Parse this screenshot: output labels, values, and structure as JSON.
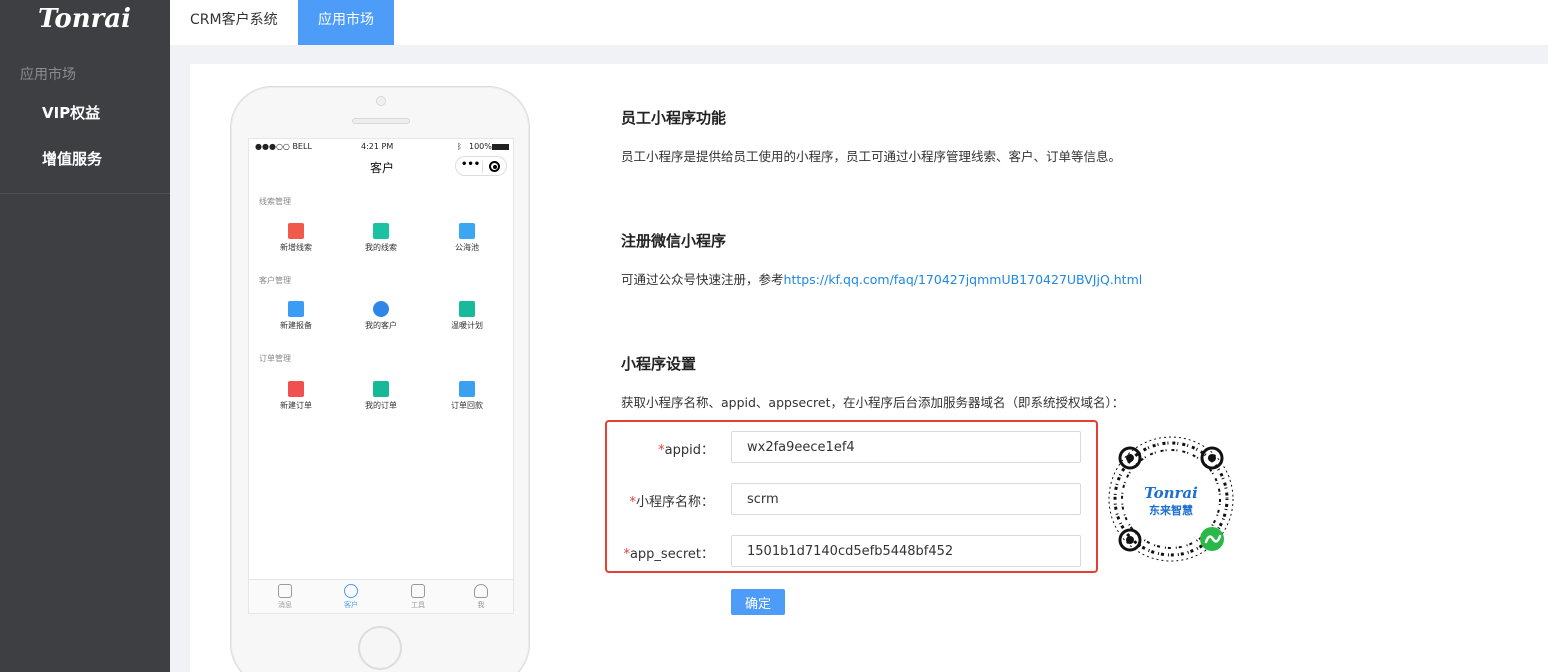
{
  "brand": {
    "name": "Tonrai"
  },
  "sidebar": {
    "group_label": "应用市场",
    "items": [
      {
        "label": "VIP权益"
      },
      {
        "label": "增值服务"
      }
    ]
  },
  "tabs": [
    {
      "label": "CRM客户系统",
      "active": false
    },
    {
      "label": "应用市场",
      "active": true
    }
  ],
  "phone": {
    "carrier": "●●●○○ BELL",
    "time": "4:21 PM",
    "battery": "100%",
    "nav_title": "客户",
    "sections": [
      {
        "label": "线索管理",
        "items": [
          "新增线索",
          "我的线索",
          "公海池"
        ]
      },
      {
        "label": "客户管理",
        "items": [
          "新建报备",
          "我的客户",
          "温暖计划"
        ]
      },
      {
        "label": "订单管理",
        "items": [
          "新建订单",
          "我的订单",
          "订单回款"
        ]
      }
    ],
    "tabbar": [
      "消息",
      "客户",
      "工具",
      "我"
    ]
  },
  "info": [
    {
      "title": "员工小程序功能",
      "text": "员工小程序是提供给员工使用的小程序，员工可通过小程序管理线索、客户、订单等信息。"
    },
    {
      "title": "注册微信小程序",
      "text": "可通过公众号快速注册，参考",
      "link": "https://kf.qq.com/faq/170427jqmmUB170427UBVJjQ.html"
    },
    {
      "title": "小程序设置",
      "text": "获取小程序名称、appid、appsecret，在小程序后台添加服务器域名（即系统授权域名）："
    }
  ],
  "form": {
    "required_mark": "*",
    "fields": [
      {
        "label": "appid：",
        "value": "wx2fa9eece1ef4"
      },
      {
        "label": "小程序名称：",
        "value": "scrm"
      },
      {
        "label": "app_secret：",
        "value": "1501b1d7140cd5efb5448bf452"
      }
    ],
    "submit_label": "确定"
  },
  "qr": {
    "logo_text": "Tonrai",
    "caption": "东来智慧"
  },
  "colors": {
    "accent": "#4d9cf8",
    "sidebar": "#3e3f42",
    "highlight_border": "#e4402f",
    "link": "#1e88e5"
  }
}
